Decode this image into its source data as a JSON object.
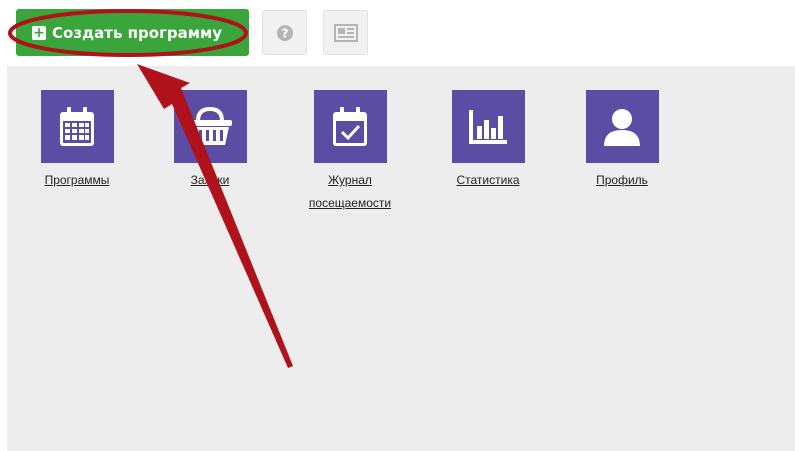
{
  "toolbar": {
    "create_button": {
      "label": "Создать программу",
      "icon": "plus-square-icon"
    },
    "help_button": {
      "icon": "question-circle-icon"
    },
    "news_button": {
      "icon": "newspaper-icon"
    }
  },
  "menu": {
    "items": [
      {
        "label": "Программы",
        "icon": "calendar-icon"
      },
      {
        "label": "Заявки",
        "icon": "basket-icon"
      },
      {
        "label_line1": "Журнал",
        "label_line2": "посещаемости",
        "icon": "calendar-check-icon"
      },
      {
        "label": "Статистика",
        "icon": "bar-chart-icon"
      },
      {
        "label": "Профиль",
        "icon": "user-icon"
      }
    ]
  },
  "colors": {
    "accent_green": "#3aa53a",
    "tile_purple": "#5a4da3",
    "annotation_red": "#b0121b",
    "content_bg": "#ededed"
  }
}
